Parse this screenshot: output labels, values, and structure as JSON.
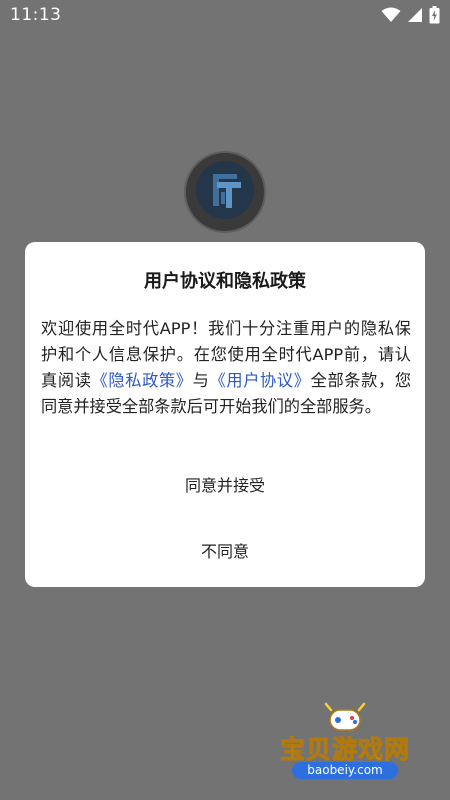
{
  "status_bar": {
    "time": "11:13"
  },
  "dialog": {
    "title": "用户协议和隐私政策",
    "body": {
      "part1": "欢迎使用全时代APP！我们十分注重用户的隐私保护和个人信息保护。在您使用全时代APP前，请认真阅读",
      "link_privacy": "《隐私政策》",
      "part2": "与",
      "link_terms": "《用户协议》",
      "part3": "全部条款，您同意并接受全部条款后可开始我们的全部服务。"
    },
    "agree_label": "同意并接受",
    "disagree_label": "不同意"
  },
  "watermark": {
    "text": "宝贝游戏网",
    "url": "baobeiy.com"
  },
  "colors": {
    "overlay": "#737373",
    "link": "#2f58c8",
    "dialog_bg": "#ffffff"
  },
  "icons": [
    "wifi-icon",
    "signal-icon",
    "battery-icon",
    "app-logo-icon"
  ]
}
